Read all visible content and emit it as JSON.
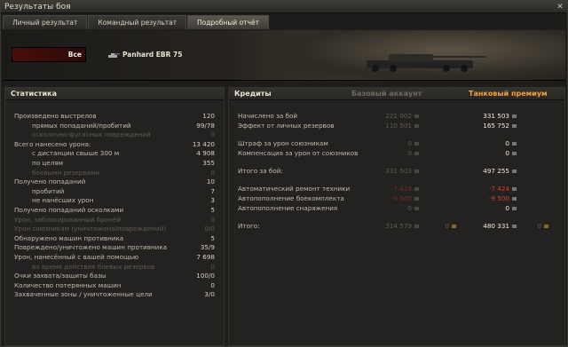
{
  "window": {
    "title": "Результаты боя",
    "close": "✕"
  },
  "tabs": [
    "Личный результат",
    "Командный результат",
    "Подробный отчёт"
  ],
  "selector": {
    "label": "Все"
  },
  "vehicle": {
    "name": "Panhard EBR 75"
  },
  "stats": {
    "title": "Статистика",
    "rows": [
      {
        "label": "Произведено выстрелов",
        "value": "120",
        "indent": 0,
        "dim": false
      },
      {
        "label": "прямых попаданий/пробитий",
        "value": "99/78",
        "indent": 1,
        "dim": false
      },
      {
        "label": "осколочно-фугасных повреждений",
        "value": "0",
        "indent": 1,
        "dim": true
      },
      {
        "label": "Всего нанесено урона:",
        "value": "13 420",
        "indent": 0,
        "dim": false
      },
      {
        "label": "с дистанции свыше 300 м",
        "value": "4 908",
        "indent": 1,
        "dim": false
      },
      {
        "label": "по целям",
        "value": "355",
        "indent": 1,
        "dim": false
      },
      {
        "label": "боевыми резервами",
        "value": "0",
        "indent": 1,
        "dim": true
      },
      {
        "label": "Получено попаданий",
        "value": "10",
        "indent": 0,
        "dim": false
      },
      {
        "label": "пробитий",
        "value": "7",
        "indent": 1,
        "dim": false
      },
      {
        "label": "не нанёсших урон",
        "value": "3",
        "indent": 1,
        "dim": false
      },
      {
        "label": "Получено попаданий осколками",
        "value": "5",
        "indent": 0,
        "dim": false
      },
      {
        "label": "Урон, заблокированный бронёй",
        "value": "0",
        "indent": 0,
        "dim": true
      },
      {
        "label": "Урон союзникам (уничтожено/повреждений)",
        "value": "0/0",
        "indent": 0,
        "dim": true
      },
      {
        "label": "Обнаружено машин противника",
        "value": "5",
        "indent": 0,
        "dim": false
      },
      {
        "label": "Повреждено/уничтожено машин противника",
        "value": "35/9",
        "indent": 0,
        "dim": false
      },
      {
        "label": "Урон, нанесённый с вашей помощью",
        "value": "7 698",
        "indent": 0,
        "dim": false
      },
      {
        "label": "во время действия боевых резервов",
        "value": "0",
        "indent": 1,
        "dim": true
      },
      {
        "label": "Очки захвата/защиты базы",
        "value": "100/0",
        "indent": 0,
        "dim": false
      },
      {
        "label": "Количество потерянных машин",
        "value": "0",
        "indent": 0,
        "dim": false
      },
      {
        "label": "Захваченные зоны / уничтоженные цели",
        "value": "3/0",
        "indent": 0,
        "dim": false
      }
    ]
  },
  "credits": {
    "title": "Кредиты",
    "col_basic": "Базовый аккаунт",
    "col_premium": "Танковый премиум",
    "rows": [
      {
        "label": "Начислено за бой",
        "basic": "221 002",
        "premium": "331 503",
        "red": false,
        "gap": 0
      },
      {
        "label": "Эффект от личных резервов",
        "basic": "110 501",
        "premium": "165 752",
        "red": false,
        "gap": 0
      },
      {
        "label": "Штраф за урон союзникам",
        "basic": "0",
        "premium": "0",
        "red": false,
        "gap": 1
      },
      {
        "label": "Компенсация за урон от союзников",
        "basic": "0",
        "premium": "0",
        "red": false,
        "gap": 0
      },
      {
        "label": "Итого за бой:",
        "basic": "331 503",
        "premium": "497 255",
        "red": false,
        "gap": 1
      },
      {
        "label": "Автоматический ремонт техники",
        "basic": "-7 424",
        "premium": "-7 424",
        "red": true,
        "gap": 1
      },
      {
        "label": "Автопополнение боекомплекта",
        "basic": "-9 500",
        "premium": "-9 500",
        "red": true,
        "gap": 0
      },
      {
        "label": "Автопополнение снаряжения",
        "basic": "0",
        "premium": "0",
        "red": false,
        "gap": 0
      },
      {
        "label": "Итого:",
        "basic": "314 579",
        "premium": "480 331",
        "red": false,
        "gap": 1
      }
    ],
    "gold_basic": "0",
    "gold_premium": "0"
  }
}
